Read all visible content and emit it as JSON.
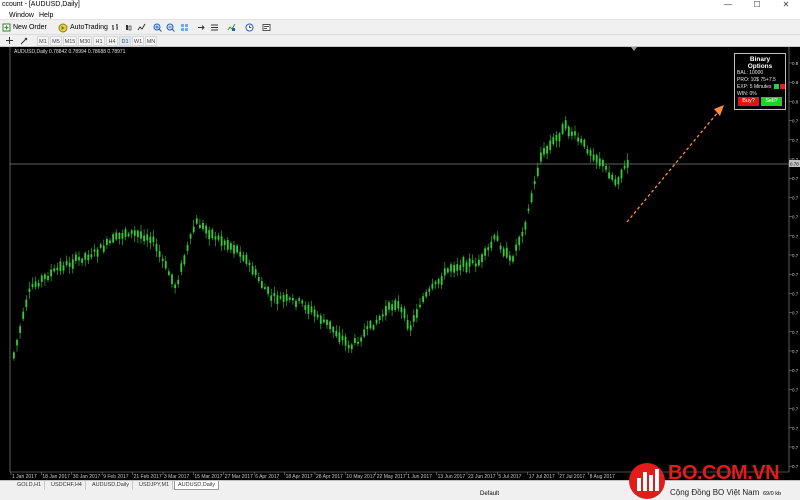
{
  "window": {
    "title": "ccount - [AUDUSD,Daily]",
    "min_glyph": "—",
    "max_glyph": "☐",
    "close_glyph": "✕"
  },
  "menu": [
    "Window",
    "Help"
  ],
  "toolbar": {
    "new_order": "New Order",
    "auto_trading": "AutoTrading"
  },
  "timeframes": [
    "M1",
    "M5",
    "M15",
    "M30",
    "H1",
    "H4",
    "D1",
    "W1",
    "MN"
  ],
  "chart": {
    "symbol_info": "AUDUSD,Daily  0.78842 0.78994 0.78688 0.78971",
    "dates": [
      "1 Jan 2017",
      "18 Jan 2017",
      "30 Jan 2017",
      "9 Feb 2017",
      "21 Feb 2017",
      "3 Mar 2017",
      "15 Mar 2017",
      "27 Mar 2017",
      "6 Apr 2017",
      "18 Apr 2017",
      "28 Apr 2017",
      "10 May 2017",
      "22 May 2017",
      "1 Jun 2017",
      "13 Jun 2017",
      "23 Jun 2017",
      "5 Jul 2017",
      "17 Jul 2017",
      "27 Jul 2017",
      "8 Aug 2017"
    ],
    "price_labels": [
      "0.8",
      "0.8",
      "0.8",
      "0.7",
      "0.7",
      "0.7",
      "0.7",
      "0.7",
      "0.7",
      "0.7",
      "0.7",
      "0.7",
      "0.7",
      "0.7",
      "0.7",
      "0.7",
      "0.7",
      "0.7",
      "0.7",
      "0.7",
      "0.7",
      "0.7"
    ],
    "current_price_label": "0.78",
    "colors": {
      "candle": "#32cd32",
      "wick": "#32cd32",
      "price_line": "#c0c0c0",
      "arrow": "#ff8a3d"
    }
  },
  "binary_options": {
    "title": "Binary Options",
    "bal": "BAL: 10000",
    "pro": "PRO: 10$  75+7.5",
    "exp": "EXP: 5 Minutes",
    "win": "WIN: 0%",
    "buy": "Buy?",
    "sell": "Sell?"
  },
  "tabs": [
    "GOLD,H1",
    "USDCHF,H4",
    "AUDUSD,Daily",
    "USDJPY,M1",
    "AUDUSD,Daily"
  ],
  "active_tab_index": 4,
  "status": {
    "profile": "Default",
    "traffic": "69/0 kb"
  },
  "brand": {
    "name": "BO.COM.VN",
    "tagline": "Cộng Đồng BO Việt Nam"
  }
}
